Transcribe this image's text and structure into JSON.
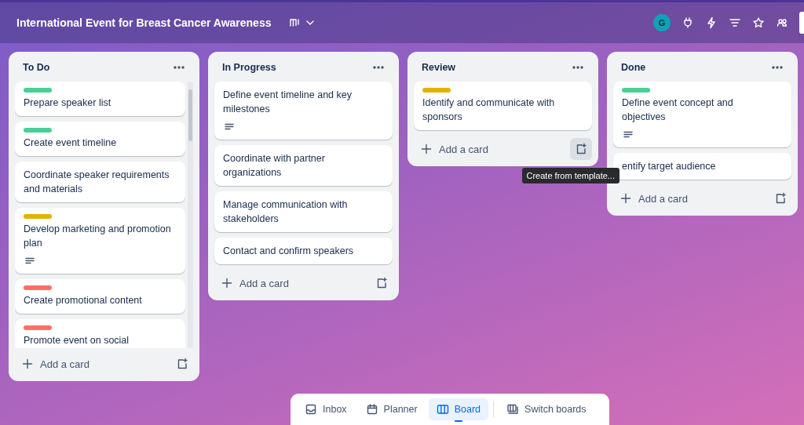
{
  "header": {
    "title": "International Event for Breast Cancer Awareness",
    "avatar": "G"
  },
  "lists": [
    {
      "title": "To Do",
      "scrollbar": true,
      "cards": [
        {
          "title": "Prepare speaker list",
          "color": "#4bce97"
        },
        {
          "title": "Create event timeline",
          "color": "#4bce97"
        },
        {
          "title": "Coordinate speaker requirements and materials"
        },
        {
          "title": "Develop marketing and promotion plan",
          "color": "#e2b203",
          "description": true
        },
        {
          "title": "Create promotional content",
          "color": "#f87168"
        },
        {
          "title": "Promote event on social",
          "color": "#f87168"
        }
      ],
      "add_label": "Add a card"
    },
    {
      "title": "In Progress",
      "cards": [
        {
          "title": "Define event timeline and key milestones",
          "description": true
        },
        {
          "title": "Coordinate with partner organizations"
        },
        {
          "title": "Manage communication with stakeholders"
        },
        {
          "title": "Contact and confirm speakers"
        }
      ],
      "add_label": "Add a card"
    },
    {
      "title": "Review",
      "cards": [
        {
          "title": "Identify and communicate with sponsors",
          "color": "#e2b203"
        }
      ],
      "add_label": "Add a card",
      "template_hover": true,
      "tooltip": "Create from template..."
    },
    {
      "title": "Done",
      "cards": [
        {
          "title": "Define event concept and objectives",
          "color": "#4bce97",
          "description": true
        },
        {
          "title": "entify target audience"
        }
      ],
      "add_label": "Add a card"
    }
  ],
  "bottom_nav": [
    {
      "kind": "inbox",
      "label": "Inbox",
      "selected": false
    },
    {
      "kind": "planner",
      "label": "Planner",
      "selected": false
    },
    {
      "kind": "board",
      "label": "Board",
      "selected": true
    },
    {
      "kind": "switch",
      "label": "Switch boards",
      "selected": false
    }
  ]
}
